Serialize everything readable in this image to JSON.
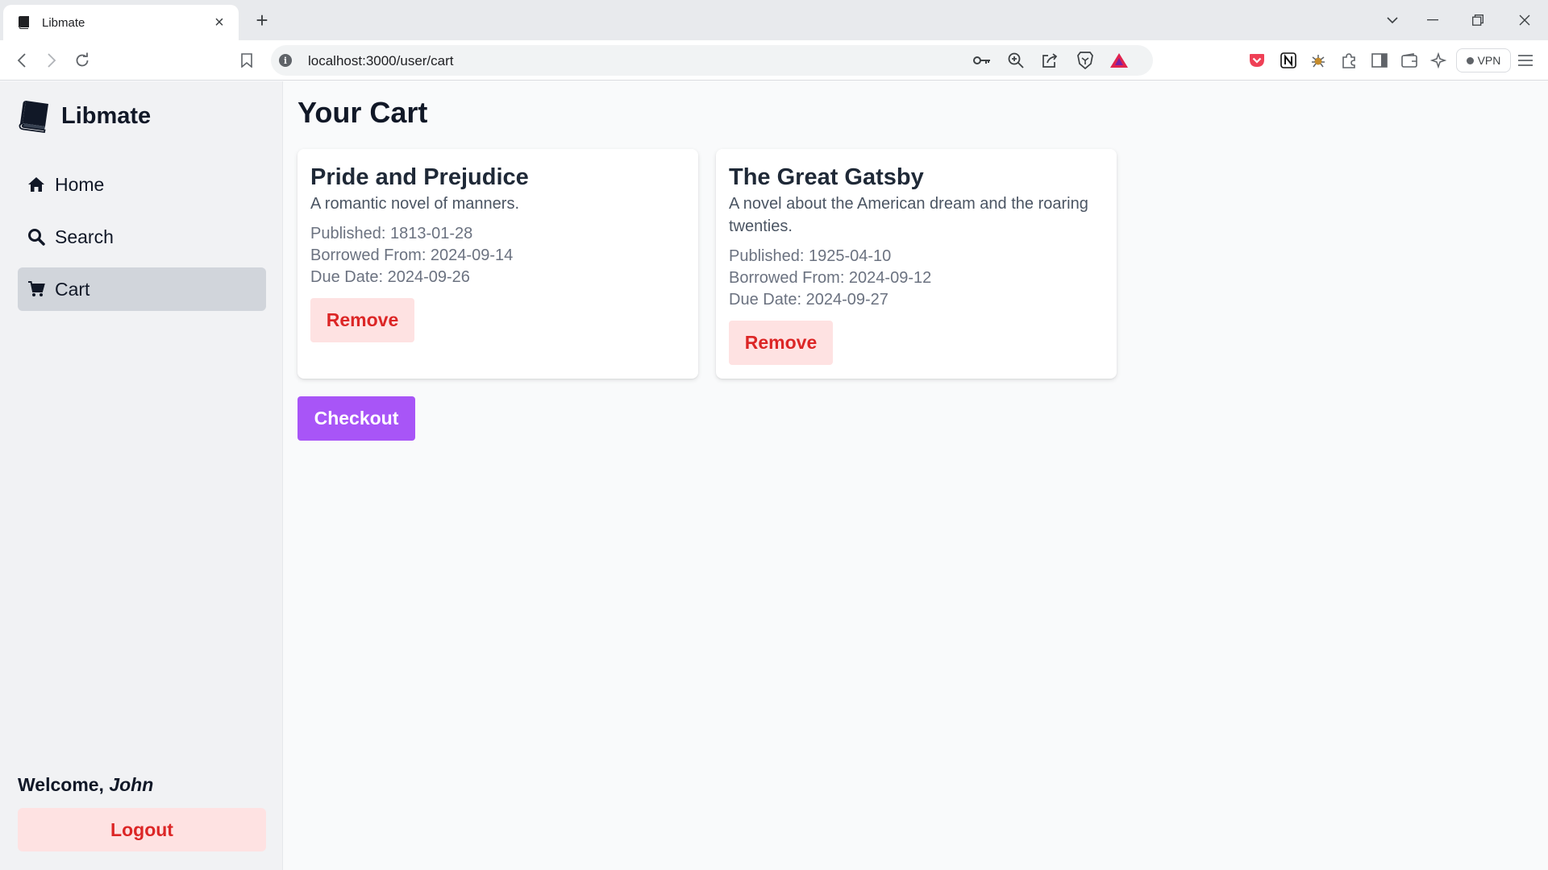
{
  "browser": {
    "tab_title": "Libmate",
    "url": "localhost:3000/user/cart",
    "vpn_label": "VPN"
  },
  "sidebar": {
    "brand": "Libmate",
    "items": [
      {
        "label": "Home",
        "icon": "home-icon",
        "active": false
      },
      {
        "label": "Search",
        "icon": "search-icon",
        "active": false
      },
      {
        "label": "Cart",
        "icon": "cart-icon",
        "active": true
      }
    ],
    "welcome_prefix": "Welcome,",
    "username": "John",
    "logout_label": "Logout"
  },
  "main": {
    "title": "Your Cart",
    "cards": [
      {
        "title": "Pride and Prejudice",
        "description": "A romantic novel of manners.",
        "published": "Published: 1813-01-28",
        "borrowed_from": "Borrowed From: 2024-09-14",
        "due_date": "Due Date: 2024-09-26",
        "remove_label": "Remove"
      },
      {
        "title": "The Great Gatsby",
        "description": "A novel about the American dream and the roaring twenties.",
        "published": "Published: 1925-04-10",
        "borrowed_from": "Borrowed From: 2024-09-12",
        "due_date": "Due Date: 2024-09-27",
        "remove_label": "Remove"
      }
    ],
    "checkout_label": "Checkout"
  },
  "colors": {
    "accent_purple": "#a855f7",
    "danger_red": "#dc2626",
    "danger_bg": "#fee2e2",
    "sidebar_bg": "#f1f2f4",
    "active_item_bg": "#d1d5db"
  }
}
